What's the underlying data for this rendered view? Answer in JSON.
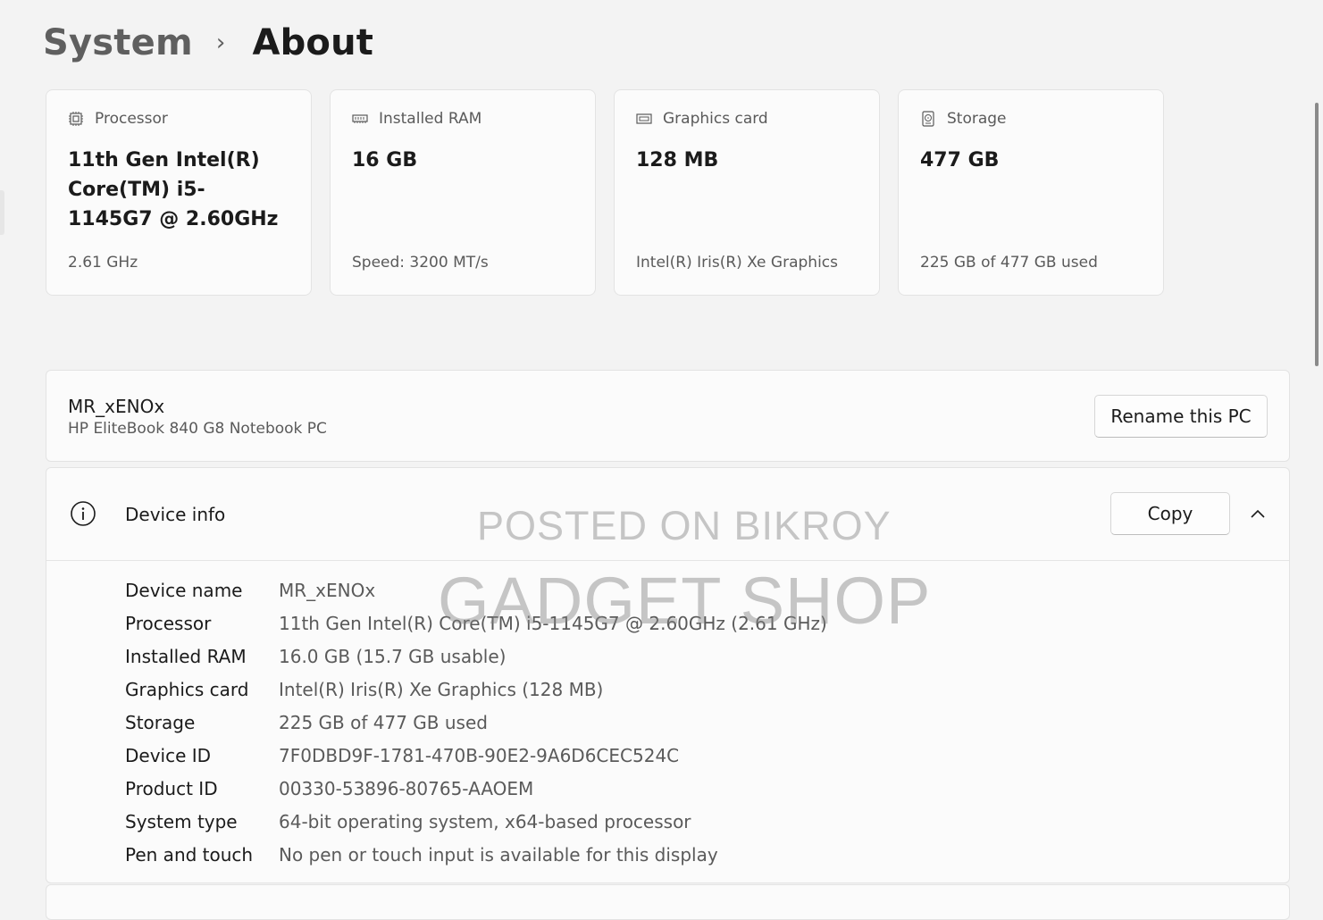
{
  "breadcrumb": {
    "parent": "System",
    "separator": "›",
    "current": "About"
  },
  "cards": [
    {
      "icon": "processor-icon",
      "title": "Processor",
      "value": "11th Gen Intel(R) Core(TM) i5-1145G7 @ 2.60GHz",
      "sub": "2.61 GHz"
    },
    {
      "icon": "ram-icon",
      "title": "Installed RAM",
      "value": "16 GB",
      "sub": "Speed: 3200 MT/s"
    },
    {
      "icon": "graphics-card-icon",
      "title": "Graphics card",
      "value": "128 MB",
      "sub": "Intel(R) Iris(R) Xe Graphics"
    },
    {
      "icon": "storage-icon",
      "title": "Storage",
      "value": "477 GB",
      "sub": "225 GB of 477 GB used"
    }
  ],
  "pc": {
    "name": "MR_xENOx",
    "model": "HP EliteBook 840 G8 Notebook PC",
    "rename_label": "Rename this PC"
  },
  "device_info": {
    "title": "Device info",
    "copy_label": "Copy",
    "rows": [
      {
        "label": "Device name",
        "value": "MR_xENOx"
      },
      {
        "label": "Processor",
        "value": "11th Gen Intel(R) Core(TM) i5-1145G7 @ 2.60GHz (2.61 GHz)"
      },
      {
        "label": "Installed RAM",
        "value": "16.0 GB (15.7 GB usable)"
      },
      {
        "label": "Graphics card",
        "value": "Intel(R) Iris(R) Xe Graphics (128 MB)"
      },
      {
        "label": "Storage",
        "value": "225 GB of 477 GB used"
      },
      {
        "label": "Device ID",
        "value": "7F0DBD9F-1781-470B-90E2-9A6D6CEC524C"
      },
      {
        "label": "Product ID",
        "value": "00330-53896-80765-AAOEM"
      },
      {
        "label": "System type",
        "value": "64-bit operating system, x64-based processor"
      },
      {
        "label": "Pen and touch",
        "value": "No pen or touch input is available for this display"
      }
    ]
  },
  "watermark": {
    "line1": "POSTED ON BIKROY",
    "line2": "GADGET SHOP"
  }
}
